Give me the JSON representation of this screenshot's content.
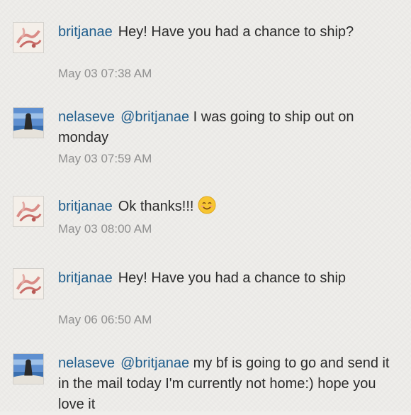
{
  "comments": [
    {
      "user": "britjanae",
      "mention": "",
      "text": "Hey! Have you had a chance to ship?",
      "time": "May 03 07:38 AM",
      "avatar": "shoes-avatar",
      "emoji": ""
    },
    {
      "user": "nelaseve",
      "mention": "@britjanae",
      "text": "I was going to ship out on monday",
      "time": "May 03 07:59 AM",
      "avatar": "beach-avatar",
      "emoji": ""
    },
    {
      "user": "britjanae",
      "mention": "",
      "text": "Ok thanks!!!",
      "time": "May 03 08:00 AM",
      "avatar": "shoes-avatar",
      "emoji": "smiling-face-icon"
    },
    {
      "user": "britjanae",
      "mention": "",
      "text": "Hey! Have you had a chance to ship",
      "time": "May 06 06:50 AM",
      "avatar": "shoes-avatar",
      "emoji": ""
    },
    {
      "user": "nelaseve",
      "mention": "@britjanae",
      "text": "my bf is going to go and send it in the mail today I'm currently not home:) hope you love it",
      "time": "",
      "avatar": "beach-avatar",
      "emoji": ""
    }
  ],
  "colors": {
    "username": "#1f5d8c",
    "text": "#2b2b2b",
    "timestamp": "#8f8f8f",
    "background": "#efeeeb"
  }
}
